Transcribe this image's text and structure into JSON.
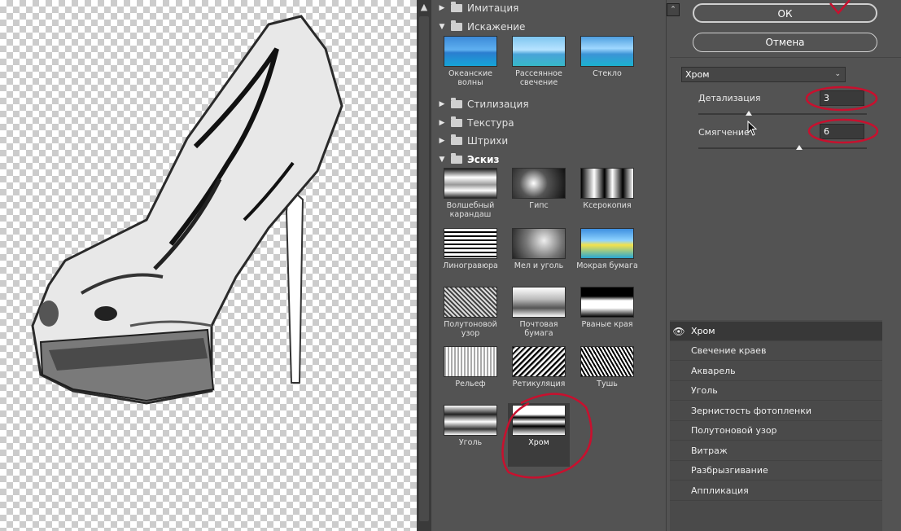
{
  "gallery": {
    "categories": [
      {
        "label": "Имитация",
        "expanded": false
      },
      {
        "label": "Искажение",
        "expanded": true
      },
      {
        "label": "Стилизация",
        "expanded": false
      },
      {
        "label": "Текстура",
        "expanded": false
      },
      {
        "label": "Штрихи",
        "expanded": false
      },
      {
        "label": "Эскиз",
        "expanded": true
      }
    ],
    "distort_filters": [
      "Океанские волны",
      "Рассеянное свечение",
      "Стекло"
    ],
    "sketch_filters": [
      "Волшебный карандаш",
      "Гипс",
      "Ксерокопия",
      "Линогравюра",
      "Мел и уголь",
      "Мокрая бумага",
      "Полутоновой узор",
      "Почтовая бумага",
      "Рваные края",
      "Рельеф",
      "Ретикуляция",
      "Тушь",
      "Уголь",
      "Хром"
    ],
    "selected_filter": "Хром"
  },
  "actions": {
    "ok_label": "ОК",
    "cancel_label": "Отмена"
  },
  "settings": {
    "filter_name": "Хром",
    "params": [
      {
        "label": "Детализация",
        "value": "3",
        "fraction": 0.3
      },
      {
        "label": "Смягчение",
        "value": "6",
        "fraction": 0.6
      }
    ]
  },
  "layers": {
    "items": [
      {
        "label": "Хром",
        "visible": true,
        "active": true
      },
      {
        "label": "Свечение краев",
        "visible": false,
        "active": false
      },
      {
        "label": "Акварель",
        "visible": false,
        "active": false
      },
      {
        "label": "Уголь",
        "visible": false,
        "active": false
      },
      {
        "label": "Зернистость фотопленки",
        "visible": false,
        "active": false
      },
      {
        "label": "Полутоновой узор",
        "visible": false,
        "active": false
      },
      {
        "label": "Витраж",
        "visible": false,
        "active": false
      },
      {
        "label": "Разбрызгивание",
        "visible": false,
        "active": false
      },
      {
        "label": "Аппликация",
        "visible": false,
        "active": false
      }
    ]
  },
  "colors": {
    "panel_bg": "#535353",
    "annotation_red": "#c8102e"
  }
}
